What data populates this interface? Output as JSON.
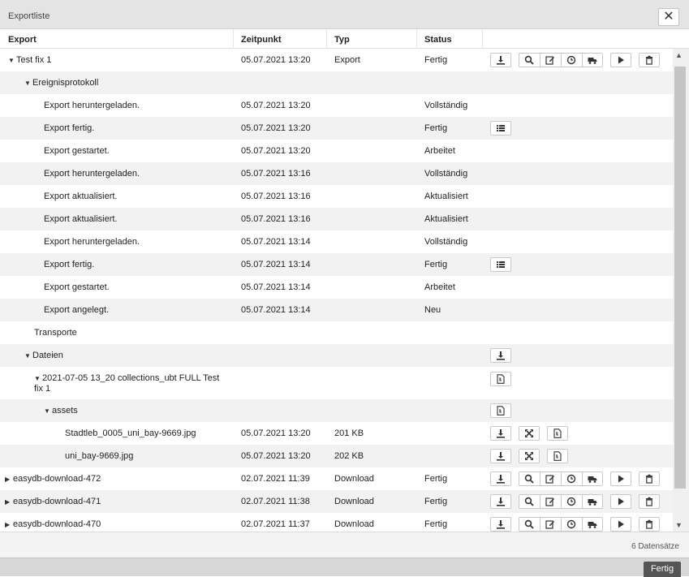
{
  "window": {
    "title": "Exportliste",
    "close": "✕"
  },
  "columns": {
    "export": "Export",
    "time": "Zeitpunkt",
    "type": "Typ",
    "status": "Status"
  },
  "rows": [
    {
      "label": "Test fix 1",
      "caret": "▼",
      "indent": 10,
      "time": "05.07.2021 13:20",
      "type": "Export",
      "status": "Fertig",
      "icons": "full",
      "alt": false
    },
    {
      "label": "Ereignisprotokoll",
      "caret": "▼",
      "indent": 30,
      "time": "",
      "type": "",
      "status": "",
      "icons": "none",
      "alt": true
    },
    {
      "label": "Export heruntergeladen.",
      "caret": "",
      "indent": 54,
      "time": "05.07.2021 13:20",
      "type": "",
      "status": "Vollständig",
      "icons": "none",
      "alt": false
    },
    {
      "label": "Export fertig.",
      "caret": "",
      "indent": 54,
      "time": "05.07.2021 13:20",
      "type": "",
      "status": "Fertig",
      "icons": "list",
      "alt": true
    },
    {
      "label": "Export gestartet.",
      "caret": "",
      "indent": 54,
      "time": "05.07.2021 13:20",
      "type": "",
      "status": "Arbeitet",
      "icons": "none",
      "alt": false
    },
    {
      "label": "Export heruntergeladen.",
      "caret": "",
      "indent": 54,
      "time": "05.07.2021 13:16",
      "type": "",
      "status": "Vollständig",
      "icons": "none",
      "alt": true
    },
    {
      "label": "Export aktualisiert.",
      "caret": "",
      "indent": 54,
      "time": "05.07.2021 13:16",
      "type": "",
      "status": "Aktualisiert",
      "icons": "none",
      "alt": false
    },
    {
      "label": "Export aktualisiert.",
      "caret": "",
      "indent": 54,
      "time": "05.07.2021 13:16",
      "type": "",
      "status": "Aktualisiert",
      "icons": "none",
      "alt": true
    },
    {
      "label": "Export heruntergeladen.",
      "caret": "",
      "indent": 54,
      "time": "05.07.2021 13:14",
      "type": "",
      "status": "Vollständig",
      "icons": "none",
      "alt": false
    },
    {
      "label": "Export fertig.",
      "caret": "",
      "indent": 54,
      "time": "05.07.2021 13:14",
      "type": "",
      "status": "Fertig",
      "icons": "list",
      "alt": true
    },
    {
      "label": "Export gestartet.",
      "caret": "",
      "indent": 54,
      "time": "05.07.2021 13:14",
      "type": "",
      "status": "Arbeitet",
      "icons": "none",
      "alt": false
    },
    {
      "label": "Export angelegt.",
      "caret": "",
      "indent": 54,
      "time": "05.07.2021 13:14",
      "type": "",
      "status": "Neu",
      "icons": "none",
      "alt": true
    },
    {
      "label": "Transporte",
      "caret": "",
      "indent": 42,
      "time": "",
      "type": "",
      "status": "",
      "icons": "none",
      "alt": false
    },
    {
      "label": "Dateien",
      "caret": "▼",
      "indent": 30,
      "time": "",
      "type": "",
      "status": "",
      "icons": "download",
      "alt": true
    },
    {
      "label": "2021-07-05 13_20 collections_ubt FULL Test fix 1",
      "caret": "▼",
      "indent": 42,
      "time": "",
      "type": "",
      "status": "",
      "icons": "file",
      "alt": false,
      "tall": true
    },
    {
      "label": "assets",
      "caret": "▼",
      "indent": 54,
      "time": "",
      "type": "",
      "status": "",
      "icons": "file",
      "alt": true
    },
    {
      "label": "Stadtleb_0005_uni_bay-9669.jpg",
      "caret": "",
      "indent": 80,
      "time": "05.07.2021 13:20",
      "type": "201 KB",
      "status": "",
      "icons": "triple",
      "alt": false
    },
    {
      "label": "uni_bay-9669.jpg",
      "caret": "",
      "indent": 80,
      "time": "05.07.2021 13:20",
      "type": "202 KB",
      "status": "",
      "icons": "triple",
      "alt": true
    },
    {
      "label": "easydb-download-472",
      "caret": "▶",
      "indent": 6,
      "time": "02.07.2021 11:39",
      "type": "Download",
      "status": "Fertig",
      "icons": "full",
      "alt": false
    },
    {
      "label": "easydb-download-471",
      "caret": "▶",
      "indent": 6,
      "time": "02.07.2021 11:38",
      "type": "Download",
      "status": "Fertig",
      "icons": "full",
      "alt": true
    },
    {
      "label": "easydb-download-470",
      "caret": "▶",
      "indent": 6,
      "time": "02.07.2021 11:37",
      "type": "Download",
      "status": "Fertig",
      "icons": "full",
      "alt": false
    }
  ],
  "status_bar": {
    "count": "6 Datensätze"
  },
  "footer": {
    "done": "Fertig"
  }
}
